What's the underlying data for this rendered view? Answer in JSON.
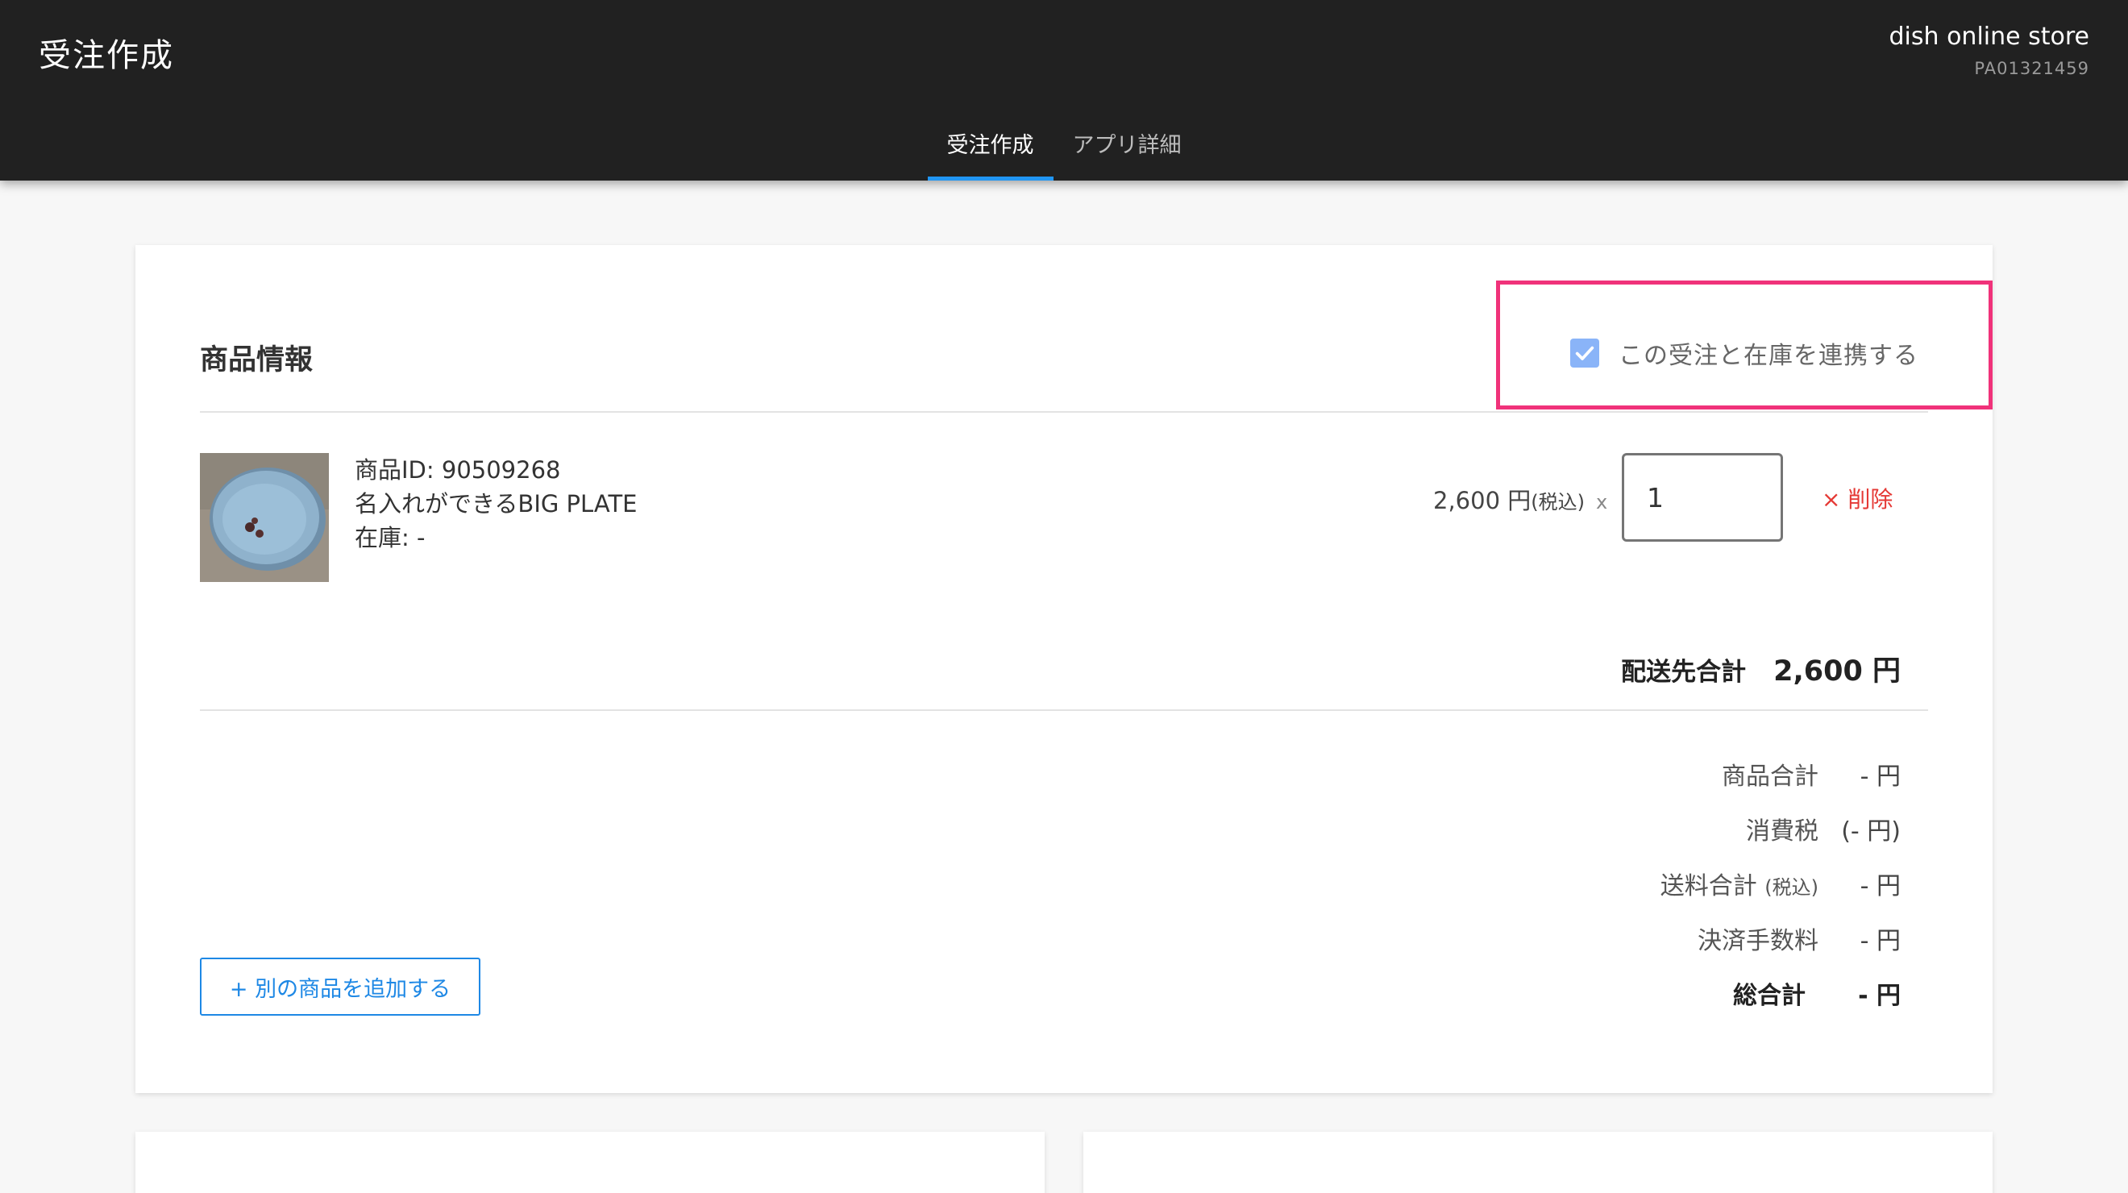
{
  "header": {
    "app_title": "受注作成",
    "store_name": "dish online store",
    "store_id": "PA01321459",
    "tabs": [
      {
        "label": "受注作成",
        "active": true
      },
      {
        "label": "アプリ詳細",
        "active": false
      }
    ]
  },
  "product_section": {
    "title": "商品情報",
    "stock_link_label": "この受注と在庫を連携する",
    "stock_link_checked": true,
    "product": {
      "id_line": "商品ID: 90509268",
      "name": "名入れができるBIG PLATE",
      "stock_line": "在庫: -",
      "price": "2,600 円",
      "tax_note": "(税込)",
      "times": "x",
      "quantity": "1",
      "delete_label": "× 削除"
    },
    "subtotal": {
      "label": "配送先合計",
      "value": "2,600 円"
    },
    "totals": [
      {
        "label": "商品合計",
        "value": "- 円"
      },
      {
        "label": "消費税",
        "value": "(- 円)"
      },
      {
        "label": "送料合計",
        "label_note": "(税込)",
        "value": "- 円"
      },
      {
        "label": "決済手数料",
        "value": "- 円"
      }
    ],
    "grand_total": {
      "label": "総合計",
      "value": "- 円"
    },
    "add_button_label": "+ 別の商品を追加する"
  },
  "colors": {
    "header_bg": "#212121",
    "accent": "#1e88e5",
    "highlight": "#f0327a",
    "delete": "#e53935",
    "checkbox": "#8ab4f8"
  }
}
